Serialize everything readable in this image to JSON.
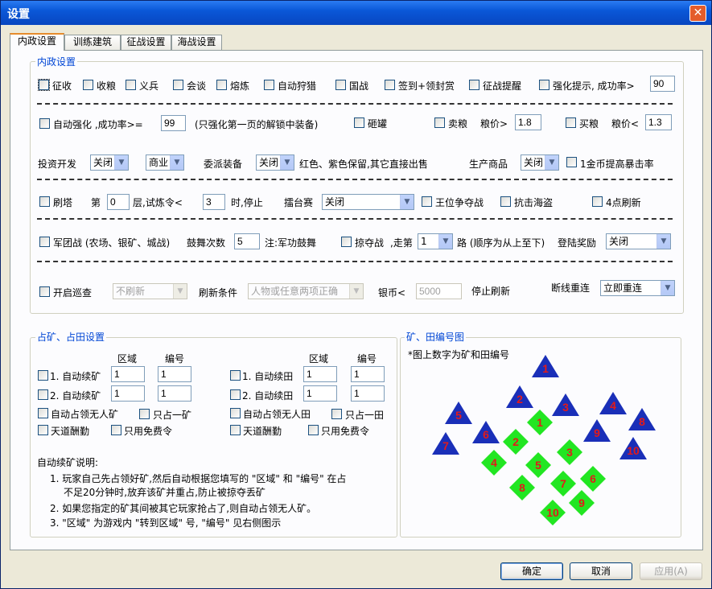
{
  "window": {
    "title": "设置",
    "close_symbol": "✕"
  },
  "tabs": [
    "内政设置",
    "训练建筑",
    "征战设置",
    "海战设置"
  ],
  "group_main": {
    "legend": "内政设置"
  },
  "row1": [
    "征收",
    "收粮",
    "义兵",
    "会谈",
    "熔炼",
    "自动狩猎",
    "国战",
    "签到+领封赏",
    "征战提醒",
    "强化提示, 成功率>"
  ],
  "row1_value": "90",
  "row2": {
    "enhance_label": "自动强化 ,成功率>=",
    "enhance_value": "99",
    "enhance_note": "(只强化第一页的解锁中装备)",
    "smash": "砸罐",
    "sell": "卖粮",
    "sell_price_label": "粮价>",
    "sell_price": "1.8",
    "buy": "买粮",
    "buy_price_label": "粮价<",
    "buy_price": "1.3"
  },
  "row3": {
    "invest_label": "投资开发",
    "invest_value": "关闭",
    "commerce_value": "商业",
    "assign_label": "委派装备",
    "assign_value": "关闭",
    "assign_note": "红色、紫色保留,其它直接出售",
    "produce_label": "生产商品",
    "produce_value": "关闭",
    "gold_label": "1金币提高暴击率"
  },
  "row4": {
    "tower": "刷塔",
    "floor_prefix": "第",
    "floor_value": "0",
    "floor_suffix": "层,试炼令<",
    "trial_value": "3",
    "trial_suffix": "时,停止",
    "arena_label": "擂台赛",
    "arena_value": "关闭",
    "king": "王位争夺战",
    "pirate": "抗击海盗",
    "refresh4": "4点刷新"
  },
  "row5": {
    "legion": "军团战 (农场、银矿、城战)",
    "drum_label": "鼓舞次数",
    "drum_value": "5",
    "drum_note": "注:军功鼓舞",
    "plunder": "掠夺战",
    "path_prefix": ",走第",
    "path_value": "1",
    "path_suffix": "路 (顺序为从上至下)",
    "land_label": "登陆奖励",
    "land_value": "关闭"
  },
  "row6": {
    "patrol": "开启巡查",
    "patrol_select": "不刷新",
    "cond_label": "刷新条件",
    "cond_value": "人物或任意两项正确",
    "silver_label": "银币<",
    "silver_value": "5000",
    "stop_label": "停止刷新",
    "reconnect_label": "断线重连",
    "reconnect_value": "立即重连"
  },
  "mine": {
    "legend": "占矿、占田设置",
    "col_area": "区域",
    "col_num": "编号",
    "left": [
      {
        "label": "1. 自动续矿",
        "area": "1",
        "num": "1"
      },
      {
        "label": "2. 自动续矿",
        "area": "1",
        "num": "1"
      }
    ],
    "right": [
      {
        "label": "1. 自动续田",
        "area": "1",
        "num": "1"
      },
      {
        "label": "2. 自动续田",
        "area": "1",
        "num": "1"
      }
    ],
    "opts_left": [
      "自动占领无人矿",
      "只占一矿",
      "天道酬勤",
      "只用免费令"
    ],
    "opts_right": [
      "自动占领无人田",
      "只占一田",
      "天道酬勤",
      "只用免费令"
    ],
    "help_title": "自动续矿说明:",
    "help_lines": [
      "1. 玩家自己先占领好矿,然后自动根据您填写的 \"区域\" 和 \"编号\" 在占",
      "不足20分钟时,放弃该矿并重占,防止被掠夺丢矿",
      "2. 如果您指定的矿其间被其它玩家抢占了,则自动占领无人矿。",
      "3. \"区域\" 为游戏内 \"转到区域\" 号, \"编号\" 见右侧图示"
    ]
  },
  "map": {
    "legend": "矿、田编号图",
    "caption": "*图上数字为矿和田编号",
    "triangles": [
      "1",
      "2",
      "3",
      "4",
      "5",
      "6",
      "7",
      "8",
      "9",
      "10"
    ],
    "diamonds": [
      "1",
      "2",
      "3",
      "4",
      "5",
      "6",
      "7",
      "8",
      "9",
      "10"
    ],
    "colors": {
      "triangle": "#1a2fb8",
      "diamond": "#22e622",
      "number": "#e31a1a"
    }
  },
  "buttons": {
    "ok": "确定",
    "cancel": "取消",
    "apply": "应用(A)"
  }
}
